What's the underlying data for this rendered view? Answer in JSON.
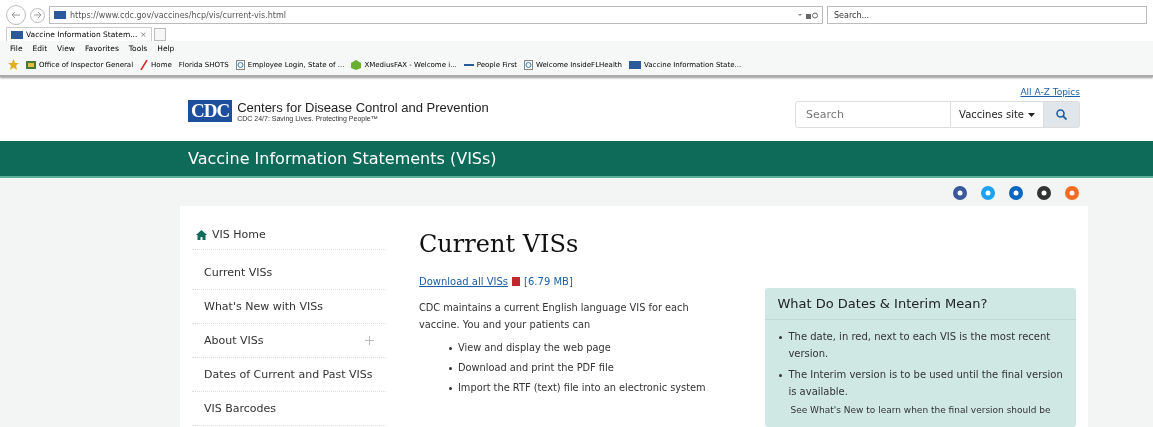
{
  "browser": {
    "url": "https://www.cdc.gov/vaccines/hcp/vis/current-vis.html",
    "search_placeholder": "Search...",
    "tab": {
      "title": "Vaccine Information Statem...",
      "close": "×"
    },
    "menu": [
      "File",
      "Edit",
      "View",
      "Favorites",
      "Tools",
      "Help"
    ],
    "favorites": [
      {
        "kind": "doc",
        "label": "Office of Inspector General"
      },
      {
        "kind": "slash",
        "label": "Home"
      },
      {
        "kind": "none",
        "label": "Florida SHOTS"
      },
      {
        "kind": "ie",
        "label": "Employee Login, State of ..."
      },
      {
        "kind": "cube",
        "label": "XMediusFAX - Welcome i..."
      },
      {
        "kind": "dash",
        "label": "People First"
      },
      {
        "kind": "ie",
        "label": "Welcome InsideFLHealth"
      },
      {
        "kind": "cdc",
        "label": "Vaccine Information State..."
      }
    ]
  },
  "site": {
    "logo": "CDC",
    "name": "Centers for Disease Control and Prevention",
    "tagline": "CDC 24/7: Saving Lives. Protecting People™",
    "az_link": "All A-Z Topics",
    "search_placeholder": "Search",
    "scope": "Vaccines site"
  },
  "banner": "Vaccine Information Statements (VISs)",
  "sidebar": [
    {
      "label": "VIS Home",
      "kind": "home",
      "expandable": false
    },
    {
      "label": "Current VISs",
      "kind": "item",
      "expandable": false
    },
    {
      "label": "What's New with VISs",
      "kind": "item",
      "expandable": false
    },
    {
      "label": "About VISs",
      "kind": "item",
      "expandable": true
    },
    {
      "label": "Dates of Current and Past VISs",
      "kind": "item",
      "expandable": false
    },
    {
      "label": "VIS Barcodes",
      "kind": "item",
      "expandable": false
    }
  ],
  "main": {
    "title": "Current VISs",
    "download_link": "Download all VISs",
    "download_size": "[6.79 MB]",
    "intro": "CDC maintains a current English language VIS for each vaccine. You and your patients can",
    "bullets": [
      "View and display the web page",
      "Download and print the PDF file",
      "Import the RTF (text) file into an electronic system"
    ]
  },
  "infobox": {
    "title": "What Do Dates & Interim Mean?",
    "bullets": [
      "The date, in red, next to each VIS is the most recent version.",
      "The Interim version is to be used until the final version is available."
    ],
    "note": "See What's New to learn when the final version should be"
  }
}
